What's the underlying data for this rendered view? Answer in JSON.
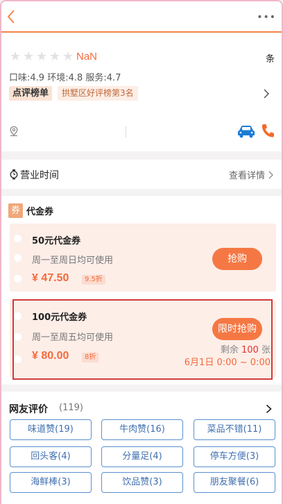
{
  "header": {
    "back_icon": "chevron-left-icon",
    "more_label": "•••"
  },
  "shop": {
    "stars": [
      "★",
      "★",
      "★",
      "★",
      "★"
    ],
    "rating": "NaN",
    "review_unit": "条",
    "scores": {
      "taste": "口味:4.9",
      "environment": "环境:4.8",
      "service": "服务:4.7"
    },
    "rank_badge": "点评榜单",
    "rank_text": "拱墅区好评榜第3名"
  },
  "hours": {
    "label": "营业时间",
    "detail": "查看详情"
  },
  "vouchers": {
    "badge": "券",
    "title": "代金券",
    "items": [
      {
        "name": "50元代金券",
        "desc": "周一至周日均可使用",
        "price": "¥ 47.50",
        "discount": "9.5折",
        "button": "抢购"
      },
      {
        "name": "100元代金券",
        "desc": "周一至周五均可使用",
        "price": "¥ 80.00",
        "discount": "8折",
        "button": "限时抢购",
        "remain_prefix": "剩余",
        "remain_num": "100",
        "remain_unit": "张",
        "date_range": "6月1日 0:00 ~ 0:00"
      }
    ]
  },
  "reviews": {
    "title": "网友评价",
    "count": "(119)",
    "tags": [
      "味道赞(19)",
      "牛肉赞(16)",
      "菜品不错(11)",
      "回头客(4)",
      "分量足(4)",
      "停车方便(3)",
      "海鲜棒(3)",
      "饮品赞(3)",
      "朋友聚餐(6)"
    ]
  },
  "colors": {
    "accent": "#f57844",
    "price": "#f36a3c",
    "tag_border": "#5b8fd0",
    "highlight_border": "#d23a3a"
  }
}
